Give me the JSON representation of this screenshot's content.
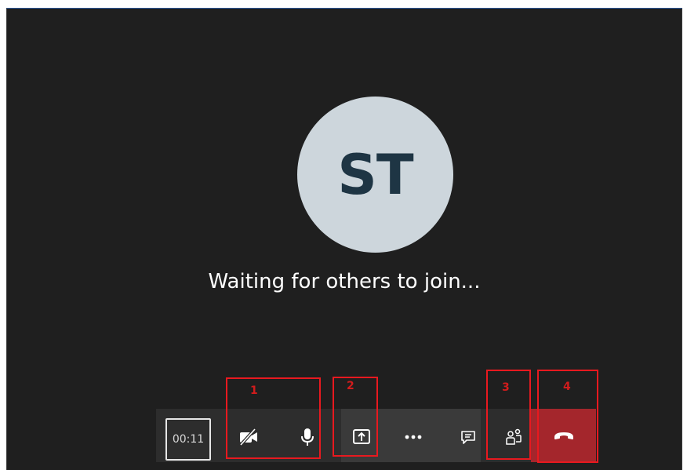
{
  "meeting": {
    "avatar_initials": "ST",
    "status_text": "Waiting for others to join..."
  },
  "toolbar": {
    "timer": "00:11",
    "icons": {
      "camera": "camera-off-icon",
      "mic": "microphone-icon",
      "share": "share-screen-icon",
      "more": "more-options-icon",
      "chat": "chat-icon",
      "participants": "participants-icon",
      "hangup": "hang-up-icon"
    }
  },
  "callouts": [
    "1",
    "2",
    "3",
    "4"
  ],
  "colors": {
    "background": "#1f1f1f",
    "toolbar": "#2d2d2d",
    "avatar": "#cdd6dc",
    "avatar_text": "#1e3544",
    "hangup": "#a4262c",
    "callout": "#e8191f"
  }
}
